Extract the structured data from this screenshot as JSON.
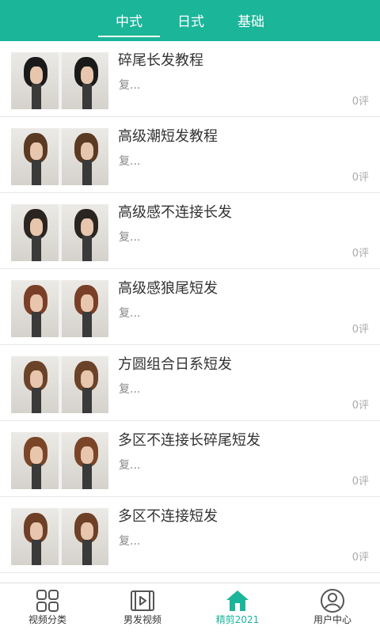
{
  "tabs": [
    "中式",
    "日式",
    "基础"
  ],
  "active_tab": 0,
  "items": [
    {
      "title": "碎尾长发教程",
      "desc": "复...",
      "comments": "0评",
      "hair_color": "#1a1a1a"
    },
    {
      "title": "高级潮短发教程",
      "desc": "复...",
      "comments": "0评",
      "hair_color": "#5a3a22"
    },
    {
      "title": "高级感不连接长发",
      "desc": "复...",
      "comments": "0评",
      "hair_color": "#2b2520"
    },
    {
      "title": "高级感狼尾短发",
      "desc": "复...",
      "comments": "0评",
      "hair_color": "#7a3f28"
    },
    {
      "title": "方圆组合日系短发",
      "desc": "复...",
      "comments": "0评",
      "hair_color": "#6a4328"
    },
    {
      "title": "多区不连接长碎尾短发",
      "desc": "复...",
      "comments": "0评",
      "hair_color": "#7b4528"
    },
    {
      "title": "多区不连接短发",
      "desc": "复...",
      "comments": "0评",
      "hair_color": "#6e4027"
    }
  ],
  "bottom_nav": [
    {
      "label": "视频分类",
      "icon": "grid-icon"
    },
    {
      "label": "男发视频",
      "icon": "video-icon"
    },
    {
      "label": "精剪2021",
      "icon": "home-icon"
    },
    {
      "label": "用户中心",
      "icon": "user-icon"
    }
  ],
  "active_nav": 2,
  "colors": {
    "accent": "#1bb59a",
    "text": "#333333",
    "muted": "#888888"
  }
}
